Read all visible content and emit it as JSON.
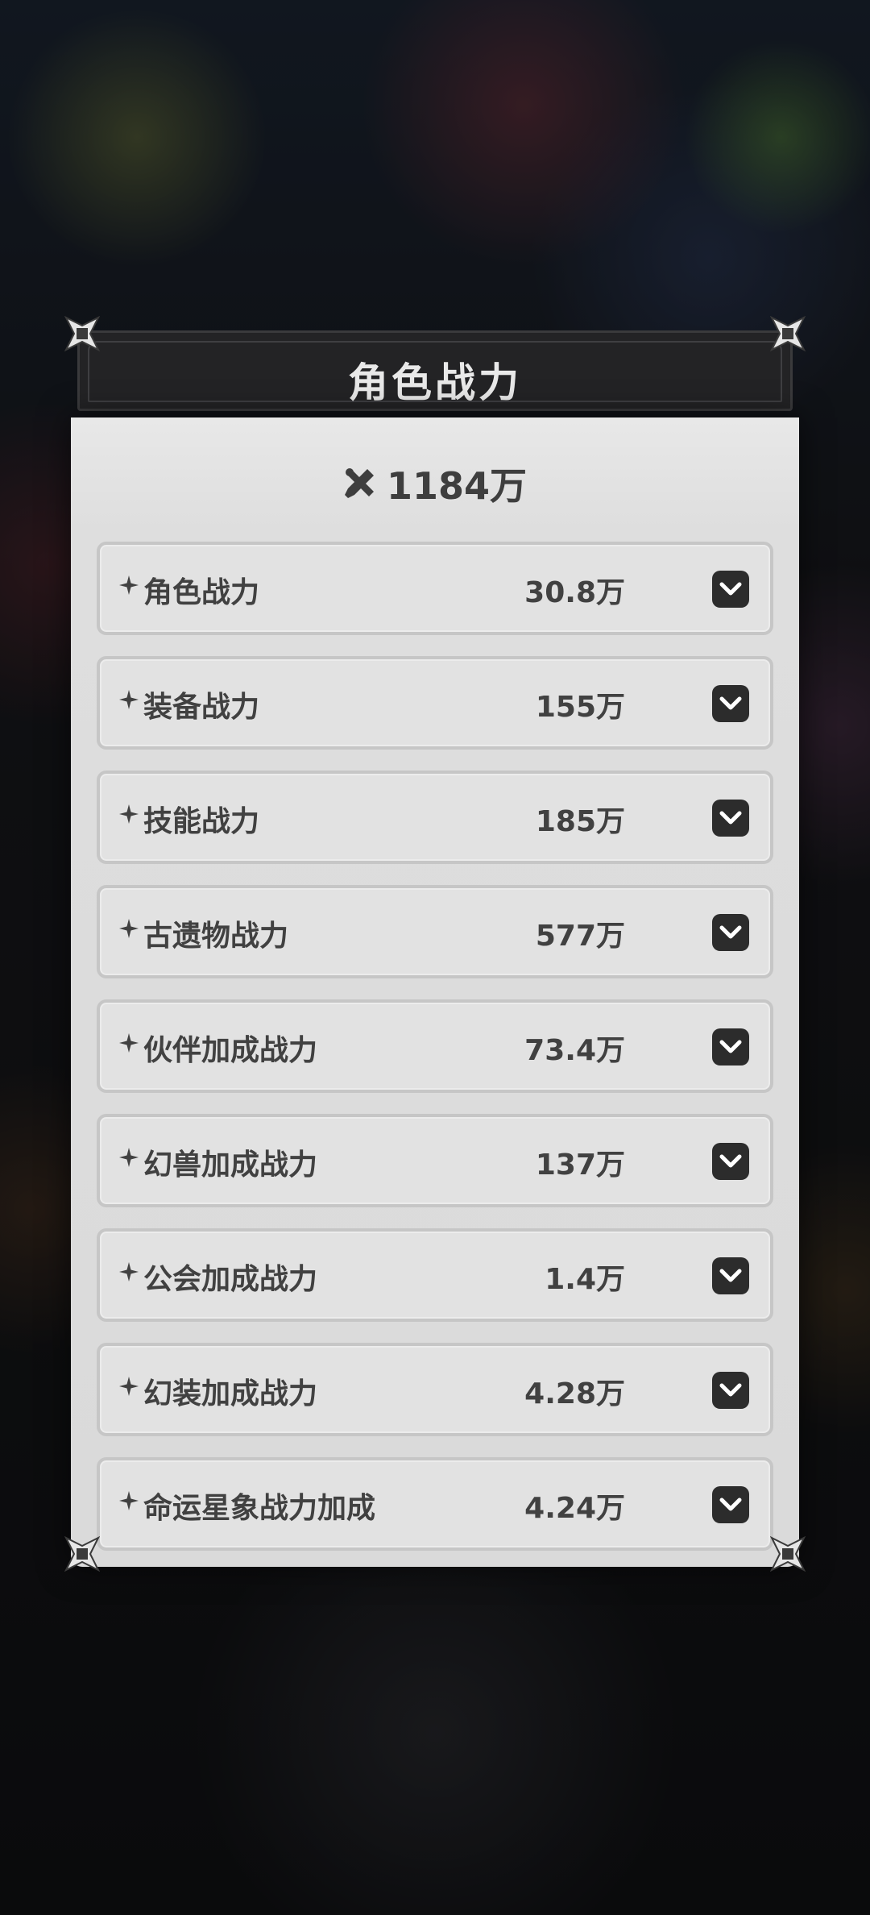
{
  "panel": {
    "title": "角色战力",
    "total_power": "1184万",
    "total_icon": "crossed-tools-icon"
  },
  "rows": [
    {
      "label": "角色战力",
      "value": "30.8万"
    },
    {
      "label": "装备战力",
      "value": "155万"
    },
    {
      "label": "技能战力",
      "value": "185万"
    },
    {
      "label": "古遗物战力",
      "value": "577万"
    },
    {
      "label": "伙伴加成战力",
      "value": "73.4万"
    },
    {
      "label": "幻兽加成战力",
      "value": "137万"
    },
    {
      "label": "公会加成战力",
      "value": "1.4万"
    },
    {
      "label": "幻装加成战力",
      "value": "4.28万"
    },
    {
      "label": "命运星象战力加成",
      "value": "4.24万"
    }
  ],
  "colors": {
    "panel_bg": "#d9d9d9",
    "header_bg": "#232325",
    "row_bg": "#e2e2e2",
    "row_border": "#c6c6c6",
    "text_dark": "#414141",
    "toggle_bg": "#2c2c2c"
  }
}
